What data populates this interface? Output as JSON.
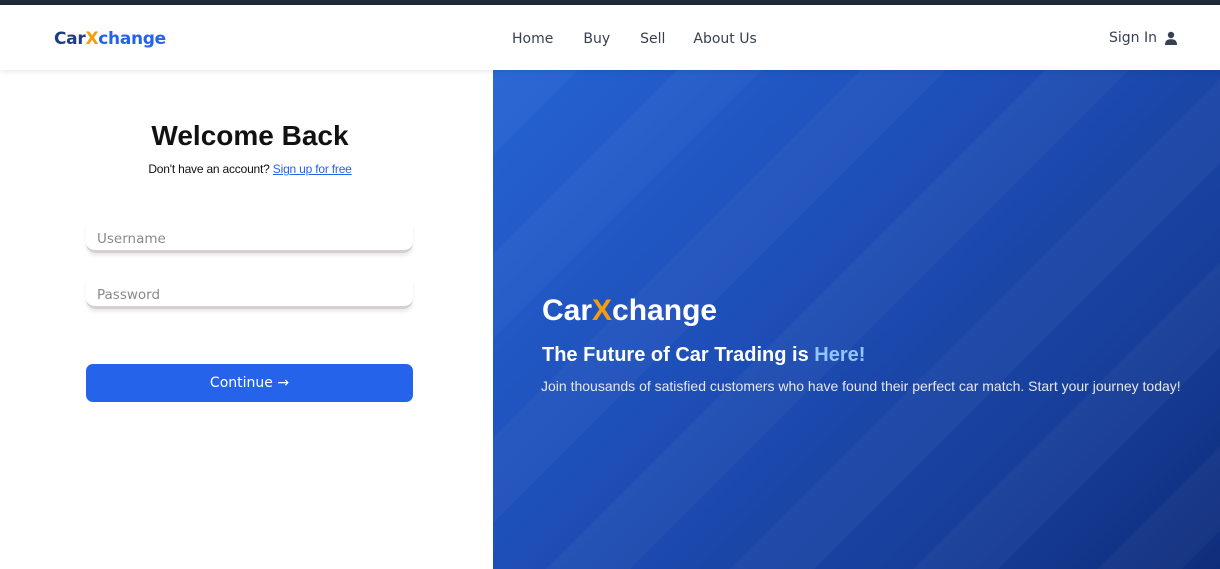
{
  "navbar": {
    "brand_prefix": "Car",
    "brand_x": "X",
    "brand_suffix": "change",
    "links": [
      "Home",
      "Buy",
      "Sell",
      "About Us"
    ],
    "signin_label": "Sign In",
    "signin_icon": "user-icon"
  },
  "login": {
    "title": "Welcome Back",
    "signup_prompt": "Don't have an account?",
    "signup_link": "Sign up for free",
    "username_placeholder": "Username",
    "password_placeholder": "Password",
    "continue_label": "Continue →"
  },
  "hero": {
    "brand_prefix": "Car",
    "brand_x": "X",
    "brand_suffix": "change",
    "title_main": "The Future of Car Trading is",
    "title_highlight": "Here!",
    "description": "Join thousands of satisfied customers who have found their perfect car match. Start your journey today!"
  },
  "colors": {
    "accent": "#2563eb",
    "brand_x": "#f59e0b",
    "hero_highlight": "#93c5fd"
  }
}
